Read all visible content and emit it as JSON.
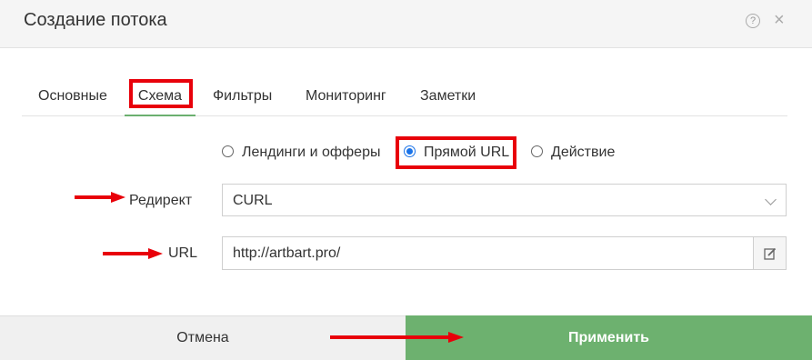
{
  "dialog": {
    "title": "Создание потока",
    "help_icon_glyph": "?",
    "close_icon_glyph": "×"
  },
  "tabs": [
    {
      "label": "Основные",
      "active": false
    },
    {
      "label": "Схема",
      "active": true
    },
    {
      "label": "Фильтры",
      "active": false
    },
    {
      "label": "Мониторинг",
      "active": false
    },
    {
      "label": "Заметки",
      "active": false
    }
  ],
  "schema_type": {
    "options": [
      {
        "label": "Лендинги и офферы",
        "checked": false
      },
      {
        "label": "Прямой URL",
        "checked": true
      },
      {
        "label": "Действие",
        "checked": false
      }
    ]
  },
  "redirect": {
    "label": "Редирект",
    "value": "CURL"
  },
  "url": {
    "label": "URL",
    "value": "http://artbart.pro/"
  },
  "footer": {
    "cancel_label": "Отмена",
    "apply_label": "Применить"
  },
  "colors": {
    "accent_green": "#6db16f",
    "annotation_red": "#e8000a",
    "radio_blue": "#1a73e8"
  },
  "icons": {
    "help": "help-icon",
    "close": "close-icon",
    "dropdown": "chevron-down-icon",
    "edit": "edit-icon",
    "annotation": "arrow-icon"
  }
}
